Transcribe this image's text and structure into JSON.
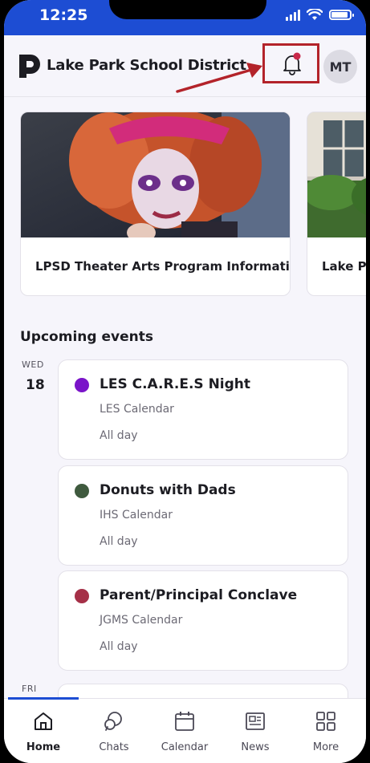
{
  "status_bar": {
    "time": "12:25"
  },
  "header": {
    "district_name": "Lake Park School District",
    "avatar_initials": "MT"
  },
  "news": [
    {
      "title": "LPSD Theater Arts Program Information"
    },
    {
      "title": "Lake Pa"
    }
  ],
  "events_section": {
    "title": "Upcoming events",
    "days": [
      {
        "weekday": "WED",
        "date": "18"
      },
      {
        "weekday": "FRI",
        "date": ""
      }
    ],
    "events": [
      {
        "name": "LES C.A.R.E.S Night",
        "calendar": "LES Calendar",
        "time": "All day",
        "color": "#7a14c9"
      },
      {
        "name": "Donuts with Dads",
        "calendar": "IHS Calendar",
        "time": "All day",
        "color": "#3f5a3e"
      },
      {
        "name": "Parent/Principal Conclave",
        "calendar": "JGMS Calendar",
        "time": "All day",
        "color": "#a53047"
      }
    ]
  },
  "tabs": [
    {
      "label": "Home",
      "icon": "home-icon",
      "active": true
    },
    {
      "label": "Chats",
      "icon": "chat-icon",
      "active": false
    },
    {
      "label": "Calendar",
      "icon": "calendar-icon",
      "active": false
    },
    {
      "label": "News",
      "icon": "news-icon",
      "active": false
    },
    {
      "label": "More",
      "icon": "grid-icon",
      "active": false
    }
  ],
  "colors": {
    "status_bar_bg": "#1d4dd3",
    "highlight_box": "#b3232a",
    "notification_dot": "#c8284a"
  }
}
